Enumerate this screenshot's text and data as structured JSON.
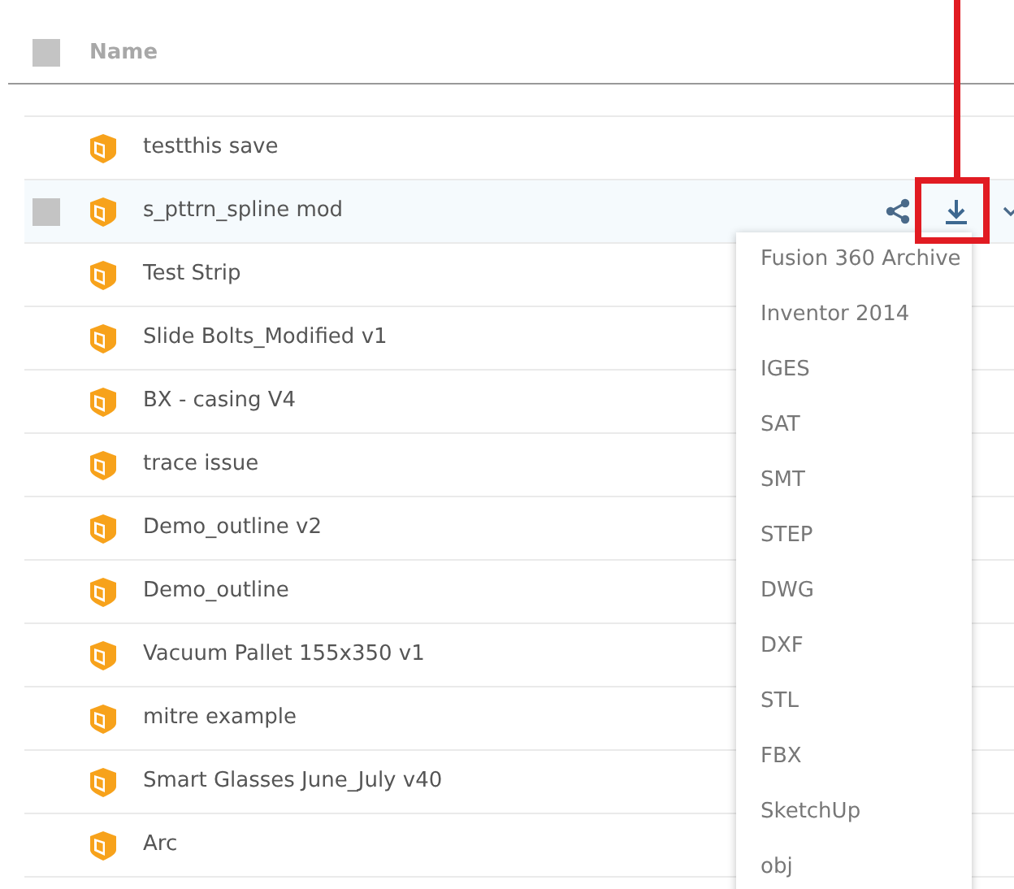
{
  "header": {
    "column": "Name",
    "checked": false
  },
  "rows": [
    {
      "name": "testthis save",
      "highlighted": false
    },
    {
      "name": "s_pttrn_spline mod",
      "highlighted": true,
      "checked": false
    },
    {
      "name": "Test Strip",
      "highlighted": false
    },
    {
      "name": "Slide Bolts_Modified v1",
      "highlighted": false
    },
    {
      "name": "BX - casing V4",
      "highlighted": false
    },
    {
      "name": "trace issue",
      "highlighted": false
    },
    {
      "name": "Demo_outline v2",
      "highlighted": false
    },
    {
      "name": "Demo_outline",
      "highlighted": false
    },
    {
      "name": "Vacuum Pallet 155x350 v1",
      "highlighted": false
    },
    {
      "name": "mitre example",
      "highlighted": false
    },
    {
      "name": "Smart Glasses June_July v40",
      "highlighted": false
    },
    {
      "name": "Arc",
      "highlighted": false
    }
  ],
  "download_menu": [
    "Fusion 360 Archive",
    "Inventor 2014",
    "IGES",
    "SAT",
    "SMT",
    "STEP",
    "DWG",
    "DXF",
    "STL",
    "FBX",
    "SketchUp",
    "obj"
  ]
}
